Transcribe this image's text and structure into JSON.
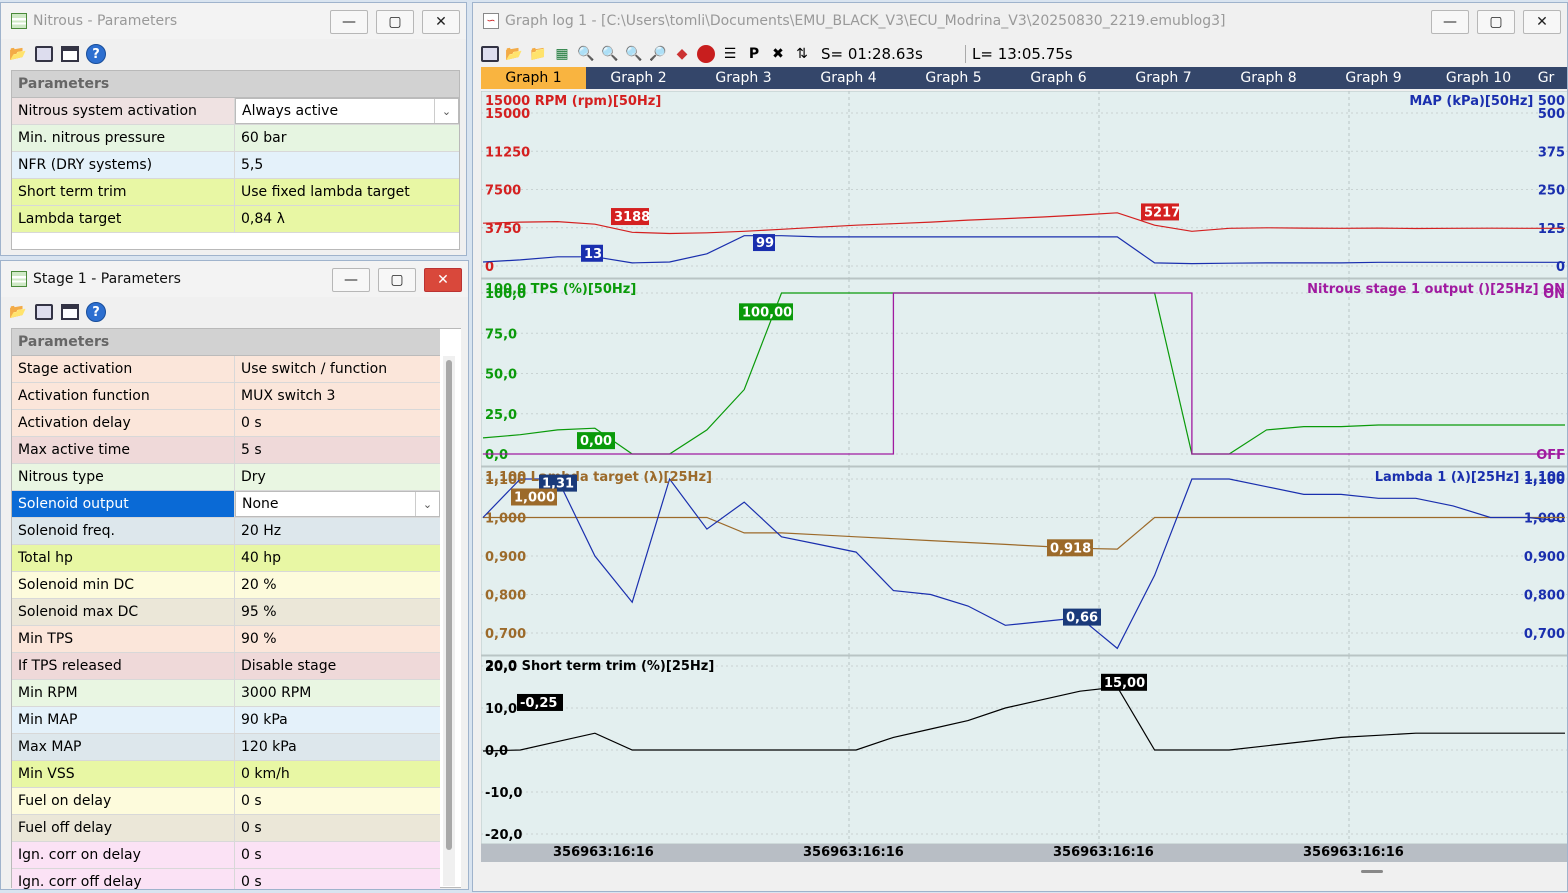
{
  "nitrous_window": {
    "title": "Nitrous - Parameters",
    "header": "Parameters",
    "rows": [
      {
        "label": "Nitrous system activation",
        "value": "Always active",
        "color": "#ffffff"
      },
      {
        "label": "Min. nitrous pressure",
        "value": "60 bar",
        "color": "#e6f5e1"
      },
      {
        "label": "NFR (DRY systems)",
        "value": "5,5",
        "color": "#e4f1fa"
      },
      {
        "label": "Short term trim",
        "value": "Use fixed lambda target",
        "color": "#e8f7a4"
      },
      {
        "label": "Lambda target",
        "value": "0,84 λ",
        "color": "#e8f7a4"
      }
    ]
  },
  "stage_window": {
    "title": "Stage 1 - Parameters",
    "header": "Parameters",
    "rows": [
      {
        "label": "Stage activation",
        "value": "Use switch / function"
      },
      {
        "label": "Activation function",
        "value": "MUX switch 3"
      },
      {
        "label": "Activation delay",
        "value": "0 s"
      },
      {
        "label": "Max active time",
        "value": "5 s"
      },
      {
        "label": "Nitrous type",
        "value": "Dry"
      },
      {
        "label": "Solenoid output",
        "value": "None"
      },
      {
        "label": "Solenoid freq.",
        "value": "20 Hz"
      },
      {
        "label": "Total hp",
        "value": "40 hp"
      },
      {
        "label": "Solenoid min DC",
        "value": "20 %"
      },
      {
        "label": "Solenoid max DC",
        "value": "95 %"
      },
      {
        "label": "Min TPS",
        "value": "90 %"
      },
      {
        "label": "If TPS released",
        "value": "Disable stage"
      },
      {
        "label": "Min RPM",
        "value": "3000 RPM"
      },
      {
        "label": "Min MAP",
        "value": "90 kPa"
      },
      {
        "label": "Max MAP",
        "value": "120 kPa"
      },
      {
        "label": "Min VSS",
        "value": "0 km/h"
      },
      {
        "label": "Fuel on  delay",
        "value": "0 s"
      },
      {
        "label": "Fuel off delay",
        "value": "0 s"
      },
      {
        "label": "Ign. corr on delay",
        "value": "0 s"
      },
      {
        "label": "Ign. corr off delay",
        "value": "0 s"
      }
    ]
  },
  "graph_window": {
    "title": "Graph log 1 - [C:\\Users\\tomli\\Documents\\EMU_BLACK_V3\\ECU_Modrina_V3\\20250830_2219.emublog3]",
    "s_value": "S= 01:28.63s",
    "l_value": "L= 13:05.75s",
    "tabs": [
      "Graph 1",
      "Graph 2",
      "Graph 3",
      "Graph 4",
      "Graph 5",
      "Graph 6",
      "Graph 7",
      "Graph 8",
      "Graph 9",
      "Graph 10",
      "Gr"
    ],
    "x_labels": [
      "356963:16:16",
      "356963:16:16",
      "356963:16:16",
      "356963:16:16"
    ]
  },
  "chart_data": [
    {
      "type": "line",
      "left_axis": "RPM (rpm)[50Hz]",
      "right_axis": "MAP (kPa)[50Hz]",
      "left_ticks": [
        "15000",
        "11250",
        "7500",
        "3750",
        "0"
      ],
      "right_ticks": [
        "500",
        "375",
        "250",
        "125",
        "0"
      ],
      "series": [
        {
          "name": "RPM",
          "color": "#d42020",
          "ylim": [
            0,
            15000
          ],
          "values": [
            4200,
            4300,
            4350,
            4100,
            3300,
            3188,
            3250,
            3400,
            3600,
            3800,
            4000,
            4150,
            4300,
            4500,
            4650,
            4800,
            5000,
            5217,
            4000,
            3400,
            3700,
            3750,
            3720,
            3700,
            3720,
            3680,
            3700,
            3710,
            3700,
            3700
          ]
        },
        {
          "name": "MAP",
          "color": "#1a2fae",
          "ylim": [
            0,
            500
          ],
          "values": [
            13,
            20,
            30,
            30,
            10,
            13,
            40,
            99,
            99,
            95,
            95,
            95,
            95,
            95,
            95,
            95,
            95,
            95,
            10,
            8,
            9,
            10,
            10,
            10,
            12,
            12,
            12,
            12,
            12,
            12
          ]
        }
      ],
      "callouts": [
        "3188",
        "99",
        "13",
        "5217"
      ]
    },
    {
      "type": "line",
      "left_axis": "TPS (%)[50Hz]",
      "right_axis": "Nitrous stage 1 output ()[25Hz]",
      "left_ticks": [
        "100,0",
        "75,0",
        "50,0",
        "25,0",
        "0,0"
      ],
      "right_ticks": [
        "ON",
        "OFF"
      ],
      "series": [
        {
          "name": "TPS",
          "color": "#0a9a0a",
          "ylim": [
            0,
            100
          ],
          "values": [
            10,
            12,
            15,
            16,
            0,
            0,
            15,
            40,
            100,
            100,
            100,
            100,
            100,
            100,
            100,
            100,
            100,
            100,
            100,
            0,
            0,
            15,
            17,
            17,
            18,
            18,
            18,
            18,
            18,
            18
          ]
        },
        {
          "name": "Nitrous stage 1 output",
          "color": "#a01aa0",
          "ylim": [
            0,
            1
          ],
          "values": [
            0,
            0,
            0,
            0,
            0,
            0,
            0,
            0,
            0,
            0,
            0,
            1,
            1,
            1,
            1,
            1,
            1,
            1,
            1,
            0,
            0,
            0,
            0,
            0,
            0,
            0,
            0,
            0,
            0,
            0
          ]
        }
      ],
      "callouts": [
        "100,00",
        "0,00"
      ]
    },
    {
      "type": "line",
      "left_axis": "Lambda target (λ)[25Hz]",
      "right_axis": "Lambda 1 (λ)[25Hz]",
      "left_ticks": [
        "1,100",
        "1,000",
        "0,900",
        "0,800",
        "0,700"
      ],
      "right_ticks": [
        "1,100",
        "1,000",
        "0,900",
        "0,800",
        "0,700"
      ],
      "series": [
        {
          "name": "Lambda target",
          "color": "#9c6a2a",
          "ylim": [
            0.7,
            1.1
          ],
          "values": [
            1.0,
            1.0,
            1.0,
            1.0,
            1.0,
            1.0,
            1.0,
            0.96,
            0.96,
            0.955,
            0.95,
            0.945,
            0.94,
            0.935,
            0.93,
            0.925,
            0.92,
            0.918,
            1.0,
            1.0,
            1.0,
            1.0,
            1.0,
            1.0,
            1.0,
            1.0,
            1.0,
            1.0,
            1.0,
            1.0
          ]
        },
        {
          "name": "Lambda 1",
          "color": "#1a2fae",
          "ylim": [
            0.7,
            1.1
          ],
          "values": [
            1.0,
            1.1,
            1.1,
            0.9,
            0.78,
            1.1,
            0.97,
            1.04,
            0.95,
            0.93,
            0.91,
            0.81,
            0.8,
            0.77,
            0.72,
            0.73,
            0.74,
            0.66,
            0.85,
            1.1,
            1.1,
            1.08,
            1.06,
            1.06,
            1.05,
            1.05,
            1.03,
            1.0,
            1.0,
            0.99
          ]
        }
      ],
      "callouts": [
        "1,31",
        "1,000",
        "0,918",
        "0,66"
      ]
    },
    {
      "type": "line",
      "left_axis": "Short term trim (%)[25Hz]",
      "right_axis": "",
      "left_ticks": [
        "20,0",
        "10,0",
        "0,0",
        "-10,0",
        "-20,0"
      ],
      "right_ticks": [],
      "series": [
        {
          "name": "Short term trim",
          "color": "#000000",
          "ylim": [
            -20,
            20
          ],
          "values": [
            -0.25,
            0,
            2,
            4,
            0,
            0,
            0,
            0,
            0,
            0,
            0,
            3,
            5,
            7,
            10,
            12,
            14,
            15,
            0,
            0,
            0,
            1,
            2,
            3,
            3.5,
            4,
            4,
            4,
            4,
            4
          ]
        }
      ],
      "callouts": [
        "-0,25",
        "15,00"
      ]
    }
  ]
}
